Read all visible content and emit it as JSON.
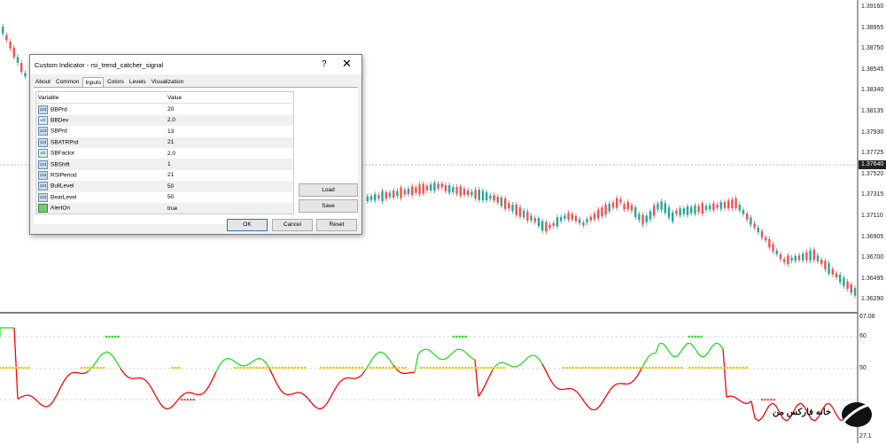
{
  "dialog": {
    "title": "Custom Indicator - rsi_trend_catcher_signal",
    "help": "?",
    "close": "✕",
    "tabs": [
      "About",
      "Common",
      "Inputs",
      "Colors",
      "Levels",
      "Visualization"
    ],
    "active_tab": "Inputs",
    "columns": [
      "Variable",
      "Value"
    ],
    "params": [
      {
        "name": "BBPrd",
        "value": "20",
        "type": "int"
      },
      {
        "name": "BBDev",
        "value": "2.0",
        "type": "float"
      },
      {
        "name": "SBPrd",
        "value": "13",
        "type": "int"
      },
      {
        "name": "SBATRPrd",
        "value": "21",
        "type": "int"
      },
      {
        "name": "SBFactor",
        "value": "2.0",
        "type": "float"
      },
      {
        "name": "SBShift",
        "value": "1",
        "type": "int"
      },
      {
        "name": "RSIPeriod",
        "value": "21",
        "type": "int"
      },
      {
        "name": "BullLevel",
        "value": "50",
        "type": "int"
      },
      {
        "name": "BearLevel",
        "value": "50",
        "type": "int"
      },
      {
        "name": "AlertOn",
        "value": "true",
        "type": "bool"
      }
    ],
    "buttons": {
      "load": "Load",
      "save": "Save",
      "ok": "OK",
      "cancel": "Cancel",
      "reset": "Reset"
    }
  },
  "price_axis": {
    "labels": [
      "1.39160",
      "1.38955",
      "1.38750",
      "1.38545",
      "1.38340",
      "1.38135",
      "1.37930",
      "1.37725",
      "1.37520",
      "1.37315",
      "1.37110",
      "1.36905",
      "1.36700",
      "1.36495",
      "1.36290"
    ],
    "current": "1.37640"
  },
  "indicator_axis": {
    "labels": [
      "67.08",
      "60",
      "50",
      "27.1"
    ]
  },
  "logo": {
    "text": "خانه فارکس من"
  },
  "colors": {
    "bull": "#26a69a",
    "bear": "#ef5350",
    "rsi_red": "#ff0000",
    "rsi_green": "#22dd22",
    "dot_yellow": "#f2c200"
  }
}
